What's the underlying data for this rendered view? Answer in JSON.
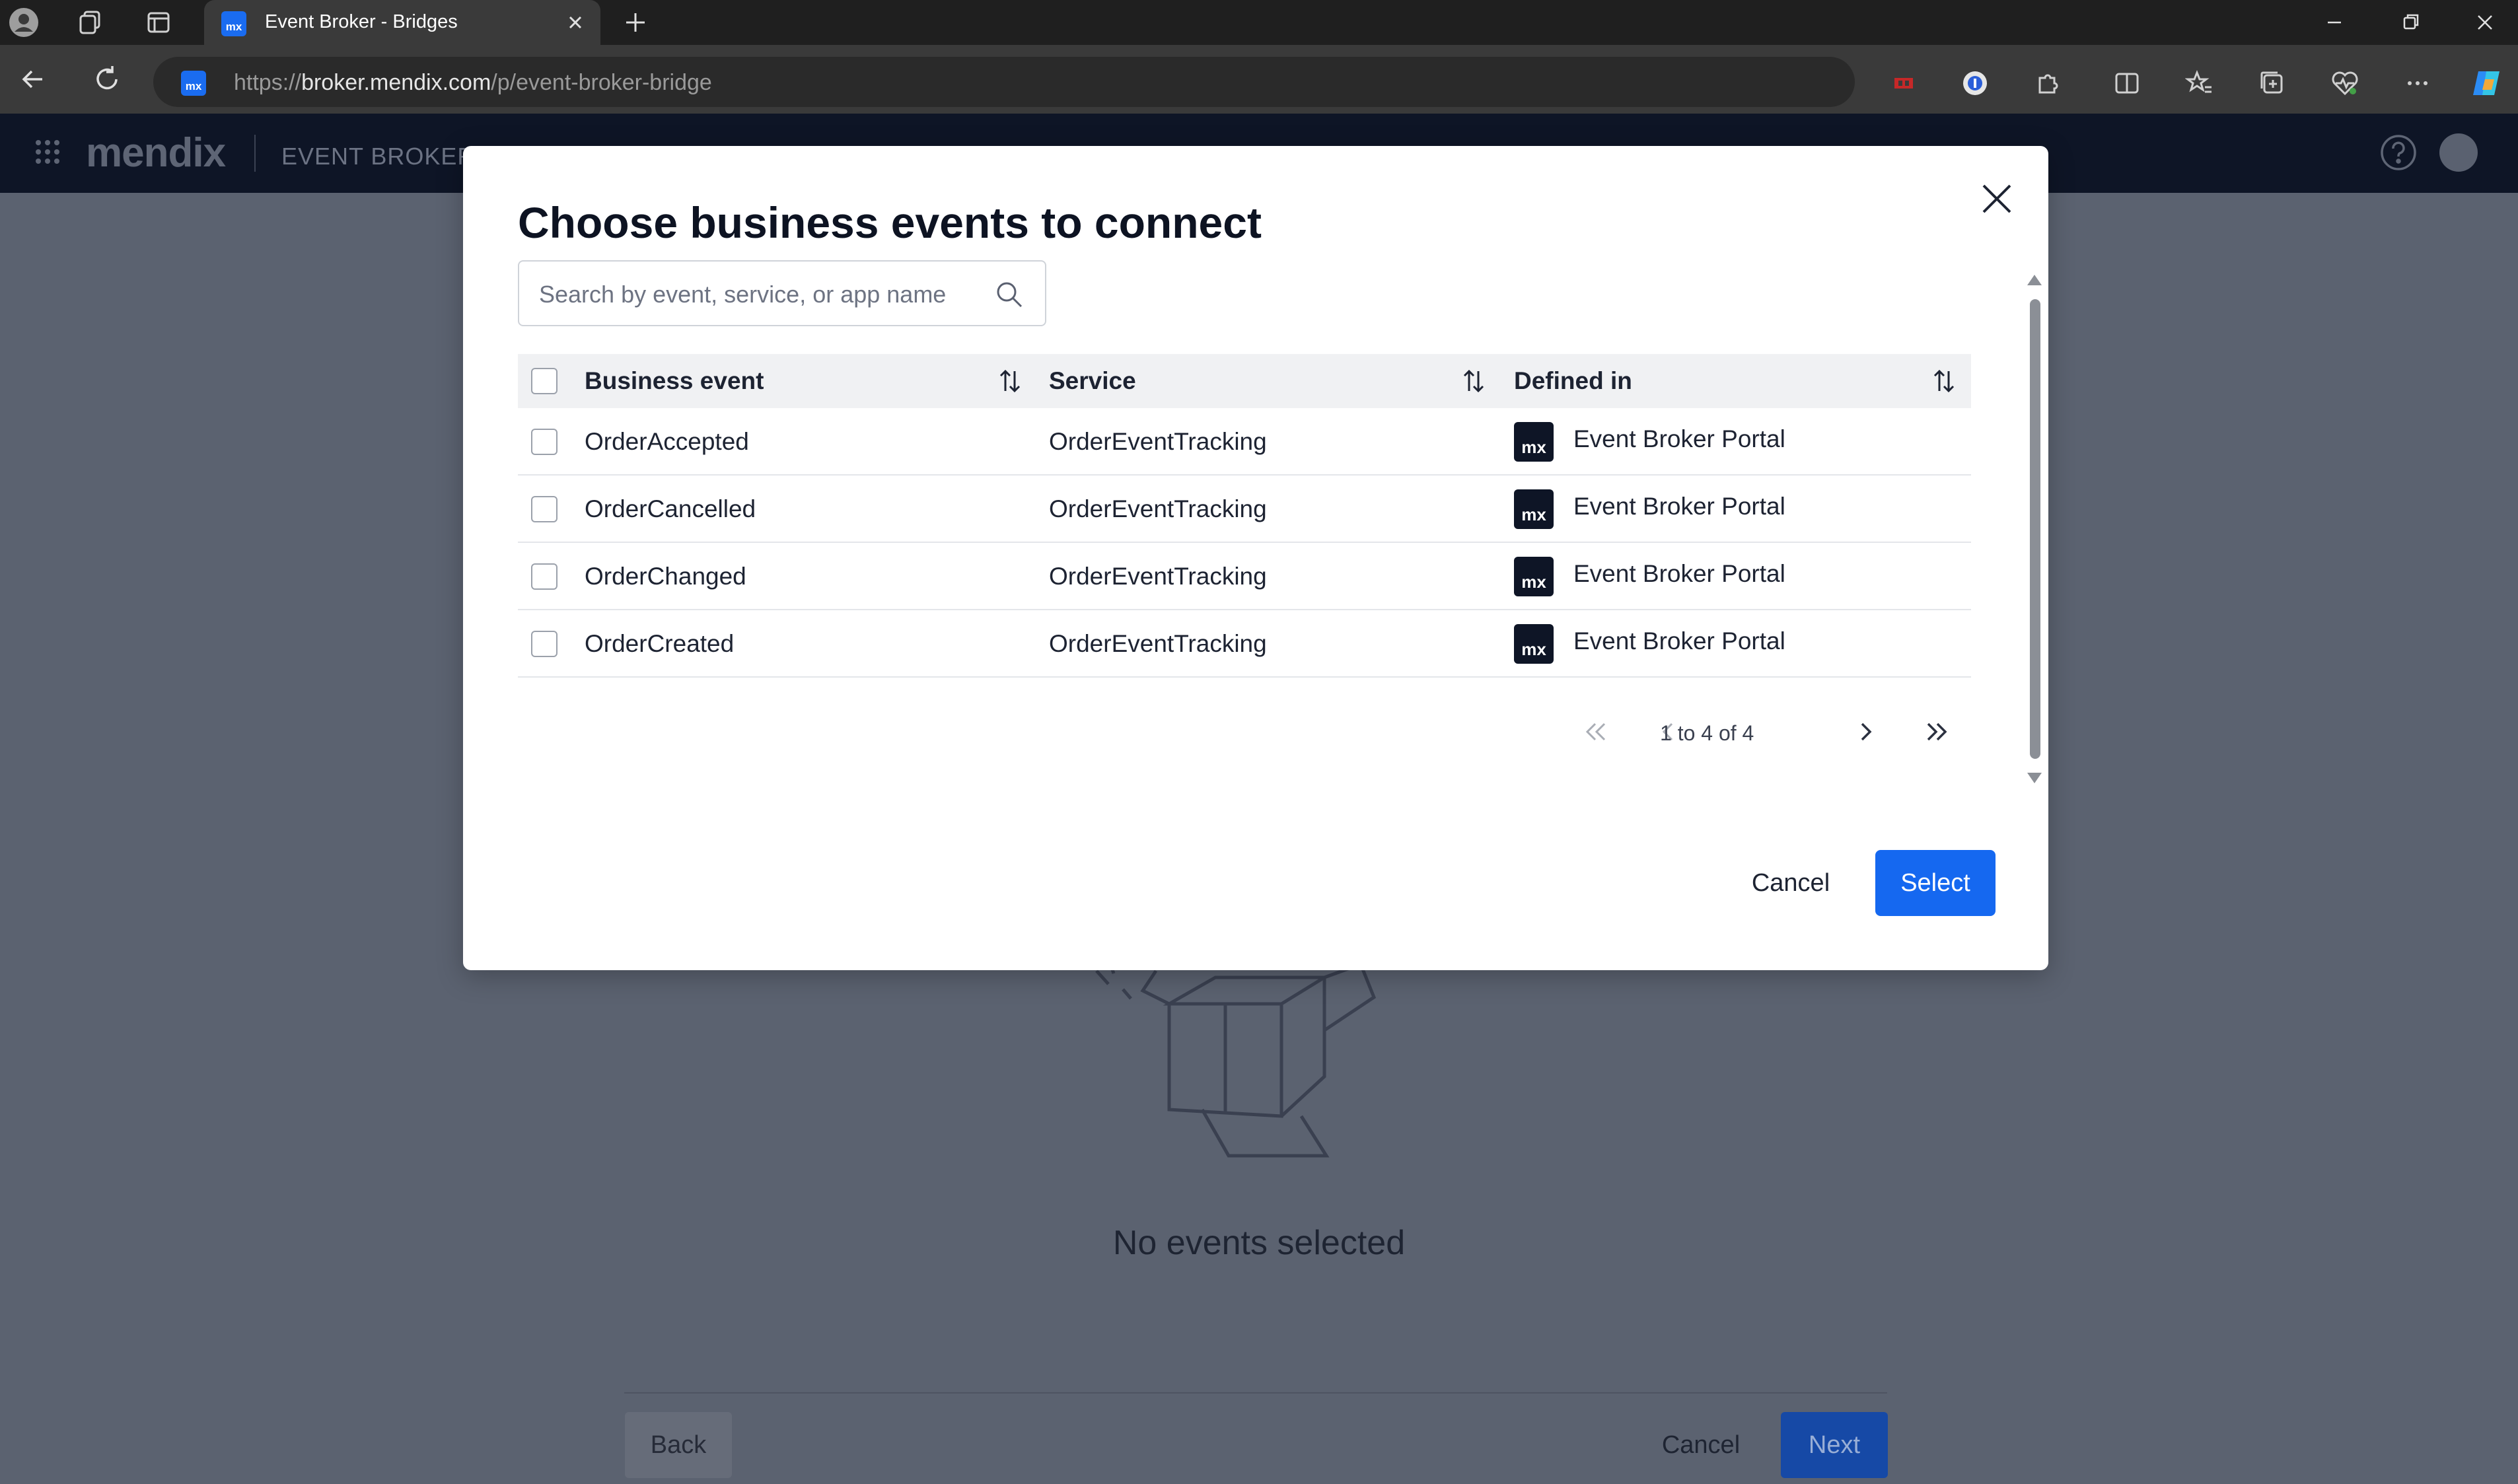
{
  "browser": {
    "tab_title": "Event Broker - Bridges",
    "favicon_text": "mx",
    "url_scheme": "https://",
    "url_host": "broker.mendix.com",
    "url_path": "/p/event-broker-bridge"
  },
  "app": {
    "logo": "mendix",
    "name": "EVENT BROKER"
  },
  "background_page": {
    "empty_state_text": "No events selected",
    "back_label": "Back",
    "cancel_label": "Cancel",
    "next_label": "Next"
  },
  "modal": {
    "title": "Choose business events to connect",
    "search_placeholder": "Search by event, service, or app name",
    "columns": [
      "Business event",
      "Service",
      "Defined in"
    ],
    "rows": [
      {
        "event": "OrderAccepted",
        "service": "OrderEventTracking",
        "defined_in": "Event Broker Portal"
      },
      {
        "event": "OrderCancelled",
        "service": "OrderEventTracking",
        "defined_in": "Event Broker Portal"
      },
      {
        "event": "OrderChanged",
        "service": "OrderEventTracking",
        "defined_in": "Event Broker Portal"
      },
      {
        "event": "OrderCreated",
        "service": "OrderEventTracking",
        "defined_in": "Event Broker Portal"
      }
    ],
    "app_badge": "mx",
    "pagination_text": "1 to 4 of 4",
    "cancel_label": "Cancel",
    "select_label": "Select"
  },
  "colors": {
    "primary": "#1568f0",
    "overlay_bg": "#5b6270",
    "appbar": "#0e1526"
  }
}
